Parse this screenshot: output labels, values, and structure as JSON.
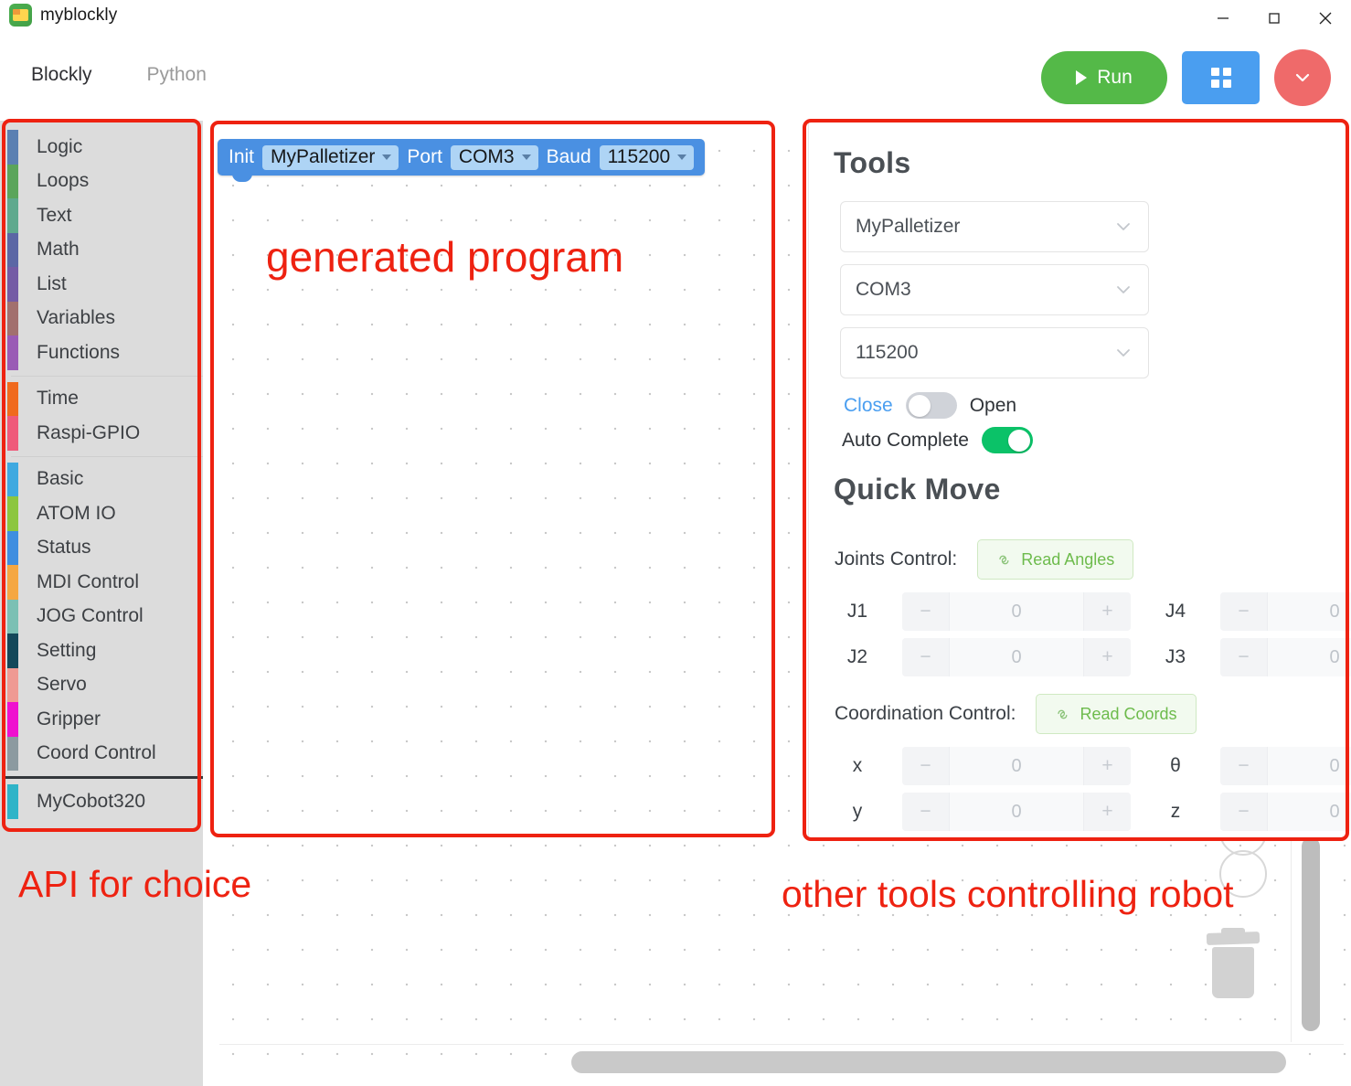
{
  "window": {
    "title": "myblockly",
    "app_icon": "app-logo-icon",
    "controls": [
      {
        "name": "minimize-button",
        "glyph": "minimize-icon"
      },
      {
        "name": "maximize-button",
        "glyph": "maximize-icon"
      },
      {
        "name": "close-button",
        "glyph": "close-icon"
      }
    ]
  },
  "toolbar": {
    "tabs": [
      {
        "label": "Blockly",
        "active": true
      },
      {
        "label": "Python",
        "active": false
      }
    ],
    "run_label": "Run",
    "run_color": "#54b948",
    "grid_button_color": "#4a9ef0",
    "dropdown_button_color": "#ef6a6a"
  },
  "sidebar": {
    "groups": [
      {
        "items": [
          {
            "label": "Logic",
            "color": "#5b80b2"
          },
          {
            "label": "Loops",
            "color": "#5ba55b"
          },
          {
            "label": "Text",
            "color": "#5fa98e"
          },
          {
            "label": "Math",
            "color": "#5b67a5"
          },
          {
            "label": "List",
            "color": "#745ba5"
          },
          {
            "label": "Variables",
            "color": "#a2706e"
          },
          {
            "label": "Functions",
            "color": "#9a5bb5"
          }
        ]
      },
      {
        "items": [
          {
            "label": "Time",
            "color": "#f06a1e"
          },
          {
            "label": "Raspi-GPIO",
            "color": "#ef5a7a"
          }
        ]
      },
      {
        "items": [
          {
            "label": "Basic",
            "color": "#3fa9e0"
          },
          {
            "label": "ATOM IO",
            "color": "#8cc63f"
          },
          {
            "label": "Status",
            "color": "#3f8ee0"
          },
          {
            "label": "MDI Control",
            "color": "#f5a742"
          },
          {
            "label": "JOG Control",
            "color": "#7bc0b4"
          },
          {
            "label": "Setting",
            "color": "#13485a"
          },
          {
            "label": "Servo",
            "color": "#ef9a93"
          },
          {
            "label": "Gripper",
            "color": "#ef11cf"
          },
          {
            "label": "Coord Control",
            "color": "#8c9aa0"
          }
        ]
      },
      {
        "strong_separator": true,
        "items": [
          {
            "label": "MyCobot320",
            "color": "#2fb4c8"
          }
        ]
      }
    ]
  },
  "canvas": {
    "block": {
      "keyword": "Init",
      "robot": "MyPalletizer",
      "port_label": "Port",
      "port": "COM3",
      "baud_label": "Baud",
      "baud": "115200",
      "color": "#4a90e2"
    },
    "trash_icon": "trash-icon",
    "zoom_in_icon": "zoom-in-icon",
    "zoom_out_icon": "zoom-out-icon"
  },
  "tools_panel": {
    "title": "Tools",
    "selects": [
      {
        "name": "robot-select",
        "value": "MyPalletizer"
      },
      {
        "name": "port-select",
        "value": "COM3"
      },
      {
        "name": "baud-select",
        "value": "115200"
      }
    ],
    "connection": {
      "close_label": "Close",
      "open_label": "Open",
      "state": "off"
    },
    "auto_complete": {
      "label": "Auto Complete",
      "state": "on",
      "on_color": "#0bc268"
    },
    "quick_move": {
      "title": "Quick Move",
      "joints": {
        "label": "Joints Control:",
        "read_button": "Read Angles",
        "fields": [
          {
            "name": "J1",
            "value": "0"
          },
          {
            "name": "J4",
            "value": "0"
          },
          {
            "name": "J2",
            "value": "0"
          },
          {
            "name": "J3",
            "value": "0"
          }
        ]
      },
      "coords": {
        "label": "Coordination Control:",
        "read_button": "Read Coords",
        "fields": [
          {
            "name": "x",
            "value": "0"
          },
          {
            "name": "θ",
            "value": "0"
          },
          {
            "name": "y",
            "value": "0"
          },
          {
            "name": "z",
            "value": "0"
          }
        ]
      },
      "stepper_minus": "−",
      "stepper_plus": "+"
    }
  },
  "annotations": {
    "color": "#ee2211",
    "generated_program": "generated program",
    "api_for_choice": "API for choice",
    "other_tools": "other tools controlling robot"
  }
}
